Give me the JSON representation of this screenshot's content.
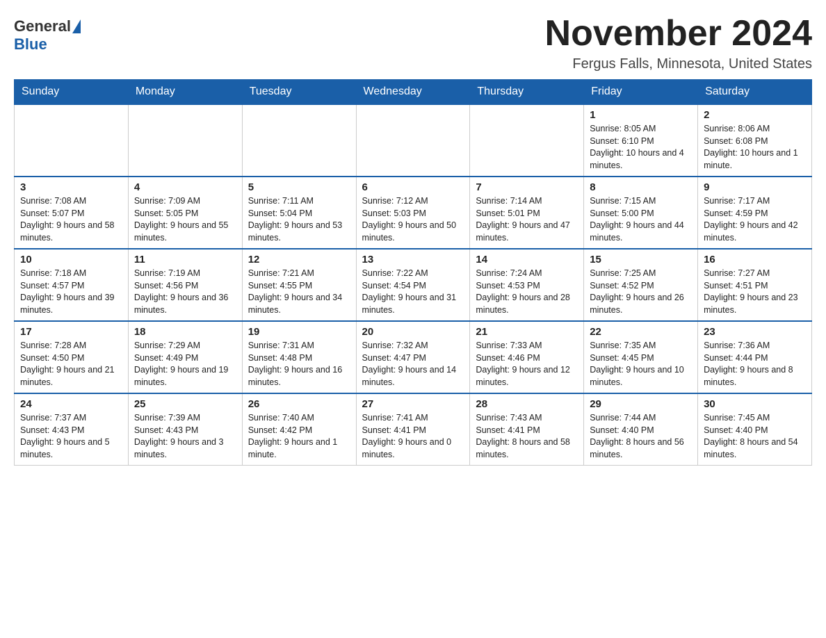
{
  "header": {
    "logo_general": "General",
    "logo_blue": "Blue",
    "title": "November 2024",
    "location": "Fergus Falls, Minnesota, United States"
  },
  "calendar": {
    "days_of_week": [
      "Sunday",
      "Monday",
      "Tuesday",
      "Wednesday",
      "Thursday",
      "Friday",
      "Saturday"
    ],
    "weeks": [
      [
        {
          "day": "",
          "info": ""
        },
        {
          "day": "",
          "info": ""
        },
        {
          "day": "",
          "info": ""
        },
        {
          "day": "",
          "info": ""
        },
        {
          "day": "",
          "info": ""
        },
        {
          "day": "1",
          "info": "Sunrise: 8:05 AM\nSunset: 6:10 PM\nDaylight: 10 hours and 4 minutes."
        },
        {
          "day": "2",
          "info": "Sunrise: 8:06 AM\nSunset: 6:08 PM\nDaylight: 10 hours and 1 minute."
        }
      ],
      [
        {
          "day": "3",
          "info": "Sunrise: 7:08 AM\nSunset: 5:07 PM\nDaylight: 9 hours and 58 minutes."
        },
        {
          "day": "4",
          "info": "Sunrise: 7:09 AM\nSunset: 5:05 PM\nDaylight: 9 hours and 55 minutes."
        },
        {
          "day": "5",
          "info": "Sunrise: 7:11 AM\nSunset: 5:04 PM\nDaylight: 9 hours and 53 minutes."
        },
        {
          "day": "6",
          "info": "Sunrise: 7:12 AM\nSunset: 5:03 PM\nDaylight: 9 hours and 50 minutes."
        },
        {
          "day": "7",
          "info": "Sunrise: 7:14 AM\nSunset: 5:01 PM\nDaylight: 9 hours and 47 minutes."
        },
        {
          "day": "8",
          "info": "Sunrise: 7:15 AM\nSunset: 5:00 PM\nDaylight: 9 hours and 44 minutes."
        },
        {
          "day": "9",
          "info": "Sunrise: 7:17 AM\nSunset: 4:59 PM\nDaylight: 9 hours and 42 minutes."
        }
      ],
      [
        {
          "day": "10",
          "info": "Sunrise: 7:18 AM\nSunset: 4:57 PM\nDaylight: 9 hours and 39 minutes."
        },
        {
          "day": "11",
          "info": "Sunrise: 7:19 AM\nSunset: 4:56 PM\nDaylight: 9 hours and 36 minutes."
        },
        {
          "day": "12",
          "info": "Sunrise: 7:21 AM\nSunset: 4:55 PM\nDaylight: 9 hours and 34 minutes."
        },
        {
          "day": "13",
          "info": "Sunrise: 7:22 AM\nSunset: 4:54 PM\nDaylight: 9 hours and 31 minutes."
        },
        {
          "day": "14",
          "info": "Sunrise: 7:24 AM\nSunset: 4:53 PM\nDaylight: 9 hours and 28 minutes."
        },
        {
          "day": "15",
          "info": "Sunrise: 7:25 AM\nSunset: 4:52 PM\nDaylight: 9 hours and 26 minutes."
        },
        {
          "day": "16",
          "info": "Sunrise: 7:27 AM\nSunset: 4:51 PM\nDaylight: 9 hours and 23 minutes."
        }
      ],
      [
        {
          "day": "17",
          "info": "Sunrise: 7:28 AM\nSunset: 4:50 PM\nDaylight: 9 hours and 21 minutes."
        },
        {
          "day": "18",
          "info": "Sunrise: 7:29 AM\nSunset: 4:49 PM\nDaylight: 9 hours and 19 minutes."
        },
        {
          "day": "19",
          "info": "Sunrise: 7:31 AM\nSunset: 4:48 PM\nDaylight: 9 hours and 16 minutes."
        },
        {
          "day": "20",
          "info": "Sunrise: 7:32 AM\nSunset: 4:47 PM\nDaylight: 9 hours and 14 minutes."
        },
        {
          "day": "21",
          "info": "Sunrise: 7:33 AM\nSunset: 4:46 PM\nDaylight: 9 hours and 12 minutes."
        },
        {
          "day": "22",
          "info": "Sunrise: 7:35 AM\nSunset: 4:45 PM\nDaylight: 9 hours and 10 minutes."
        },
        {
          "day": "23",
          "info": "Sunrise: 7:36 AM\nSunset: 4:44 PM\nDaylight: 9 hours and 8 minutes."
        }
      ],
      [
        {
          "day": "24",
          "info": "Sunrise: 7:37 AM\nSunset: 4:43 PM\nDaylight: 9 hours and 5 minutes."
        },
        {
          "day": "25",
          "info": "Sunrise: 7:39 AM\nSunset: 4:43 PM\nDaylight: 9 hours and 3 minutes."
        },
        {
          "day": "26",
          "info": "Sunrise: 7:40 AM\nSunset: 4:42 PM\nDaylight: 9 hours and 1 minute."
        },
        {
          "day": "27",
          "info": "Sunrise: 7:41 AM\nSunset: 4:41 PM\nDaylight: 9 hours and 0 minutes."
        },
        {
          "day": "28",
          "info": "Sunrise: 7:43 AM\nSunset: 4:41 PM\nDaylight: 8 hours and 58 minutes."
        },
        {
          "day": "29",
          "info": "Sunrise: 7:44 AM\nSunset: 4:40 PM\nDaylight: 8 hours and 56 minutes."
        },
        {
          "day": "30",
          "info": "Sunrise: 7:45 AM\nSunset: 4:40 PM\nDaylight: 8 hours and 54 minutes."
        }
      ]
    ]
  }
}
